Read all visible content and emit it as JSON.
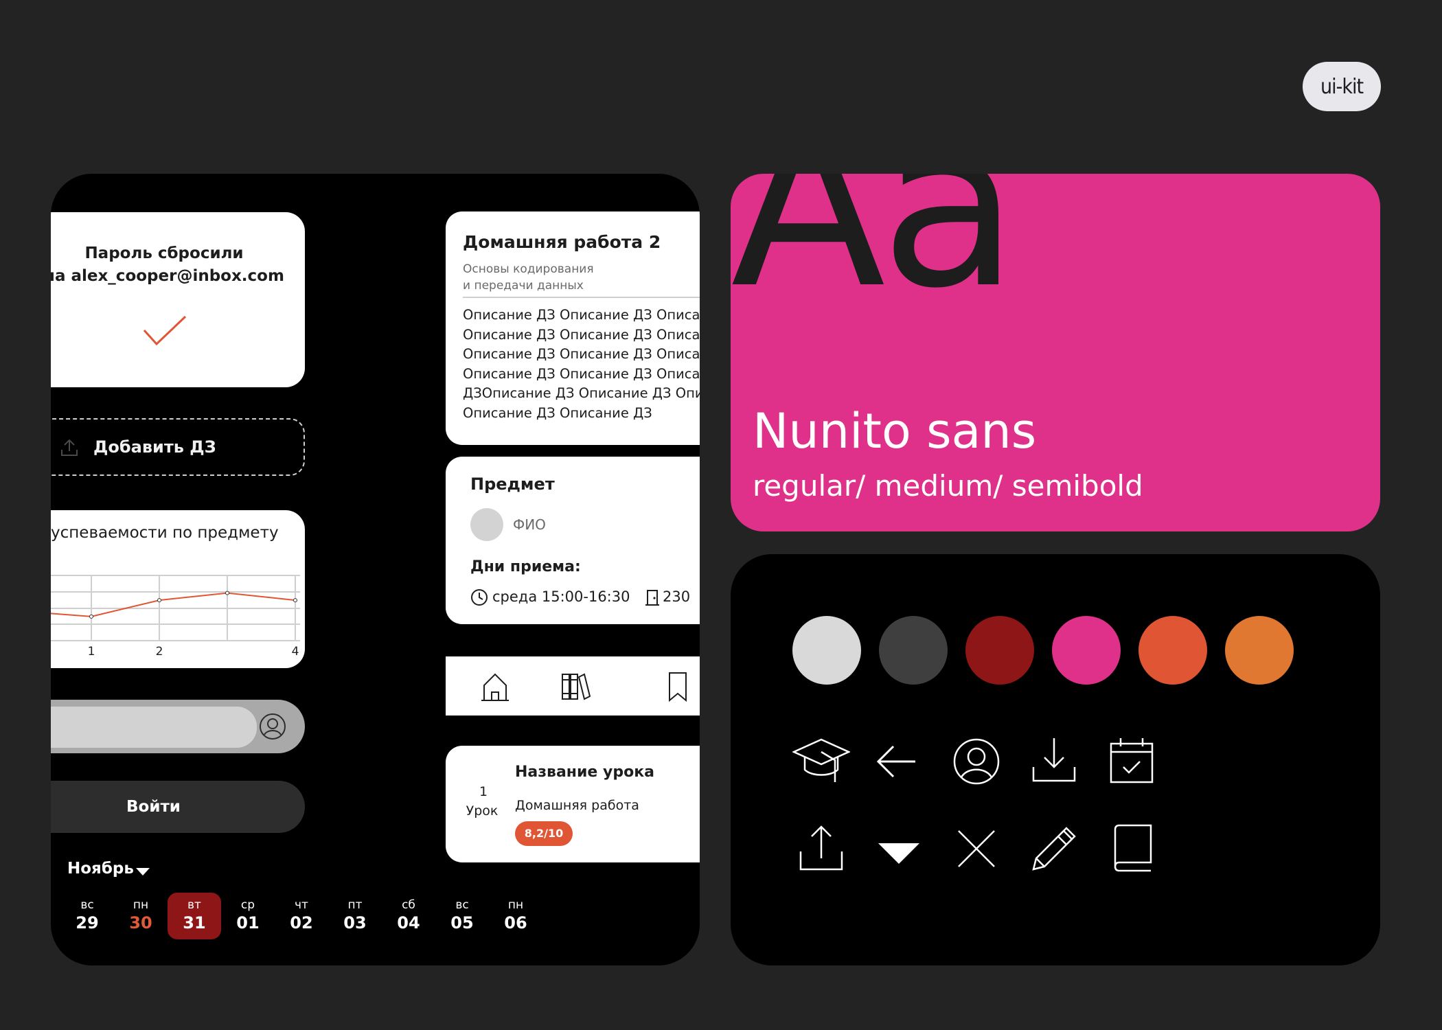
{
  "badge": {
    "label": "ui-kit"
  },
  "password_reset": {
    "line1": "Пароль сбросили",
    "line2": "на alex_cooper@inbox.com"
  },
  "add_homework": {
    "label": "Добавить ДЗ"
  },
  "chart_data": {
    "type": "line",
    "title": "успеваемости по предмету",
    "x": [
      0,
      1,
      2,
      3,
      4
    ],
    "values": [
      0.45,
      0.37,
      0.62,
      0.73,
      0.62
    ],
    "tick_labels": [
      "1",
      "2",
      "4"
    ],
    "grid": true,
    "color": "#e05534"
  },
  "search": {
    "placeholder": ""
  },
  "login": {
    "label": "Войти"
  },
  "calendar": {
    "month": "Ноябрь",
    "days": [
      {
        "weekday": "вс",
        "date": "29"
      },
      {
        "weekday": "пн",
        "date": "30"
      },
      {
        "weekday": "вт",
        "date": "31"
      },
      {
        "weekday": "ср",
        "date": "01"
      },
      {
        "weekday": "чт",
        "date": "02"
      },
      {
        "weekday": "пт",
        "date": "03"
      },
      {
        "weekday": "сб",
        "date": "04"
      },
      {
        "weekday": "вс",
        "date": "05"
      },
      {
        "weekday": "пн",
        "date": "06"
      }
    ],
    "selected_date": "31",
    "highlight_date": "30"
  },
  "homework": {
    "title": "Домашняя работа 2",
    "subject_line1": "Основы кодирования",
    "subject_line2": "и передачи данных",
    "description": "Описание ДЗ Описание ДЗ Описание\nОписание ДЗ Описание ДЗ Описание\nОписание ДЗ Описание ДЗ Описание\nОписание ДЗ Описание ДЗ Описание\nДЗОписание ДЗ Описание ДЗ Описание\nОписание ДЗ Описание ДЗ"
  },
  "subject": {
    "title": "Предмет",
    "teacher": "ФИО",
    "days_label": "Дни приема:",
    "time": "среда 15:00-16:30",
    "room": "230"
  },
  "nav": {
    "icons": [
      "home-icon",
      "books-icon",
      "bookmark-icon"
    ]
  },
  "lesson": {
    "number": "1",
    "word": "Урок",
    "title": "Название урока",
    "homework": "Домашняя работа",
    "grade": "8,2/10"
  },
  "typography": {
    "sample": "Aa",
    "font_name": "Nunito sans",
    "weights": "regular/ medium/ semibold",
    "background": "#df318a"
  },
  "palette": [
    "#d9d9d9",
    "#3f3f3f",
    "#8e1616",
    "#df318a",
    "#e05534",
    "#e07832"
  ],
  "icon_set": [
    "graduation-cap-icon",
    "arrow-left-icon",
    "user-icon",
    "download-icon",
    "calendar-check-icon",
    "upload-icon",
    "triangle-down-icon",
    "close-icon",
    "pencil-icon",
    "book-icon"
  ]
}
